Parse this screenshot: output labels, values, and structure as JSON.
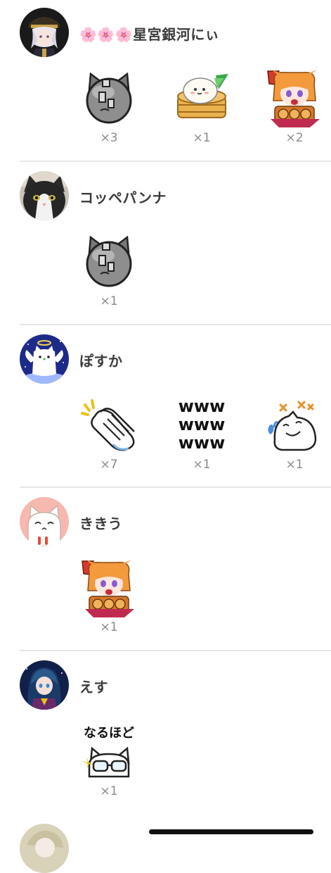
{
  "users": [
    {
      "name": "🌸🌸🌸星宮銀河にぃ",
      "avatar": "silver-haired-character-avatar",
      "stamps": [
        {
          "icon": "robot-cat-face-icon",
          "count": "×3"
        },
        {
          "icon": "steamed-bun-icon",
          "count": "×1"
        },
        {
          "icon": "orange-haired-girl-pon-icon",
          "count": "×2"
        }
      ]
    },
    {
      "name": "コッペパンナ",
      "avatar": "black-white-cat-photo-avatar",
      "stamps": [
        {
          "icon": "robot-cat-face-icon",
          "count": "×1"
        }
      ]
    },
    {
      "name": "ぽすか",
      "avatar": "angel-cat-avatar",
      "stamps": [
        {
          "icon": "clapping-hands-icon",
          "count": "×7"
        },
        {
          "icon": "www-laugh-text-icon",
          "count": "×1",
          "text": "www"
        },
        {
          "icon": "crying-laughing-cat-icon",
          "count": "×1"
        }
      ]
    },
    {
      "name": "ききう",
      "avatar": "pink-cat-avatar",
      "stamps": [
        {
          "icon": "orange-haired-girl-pon-icon",
          "count": "×1"
        }
      ]
    },
    {
      "name": "えす",
      "avatar": "dark-haired-character-avatar",
      "stamps": [
        {
          "icon": "naruhodo-glasses-cat-icon",
          "count": "×1",
          "text": "なるほど"
        }
      ]
    }
  ],
  "colors": {
    "divider": "#e6e6e6",
    "name_text": "#3b3b3b",
    "count_text": "#8a8a8a"
  }
}
